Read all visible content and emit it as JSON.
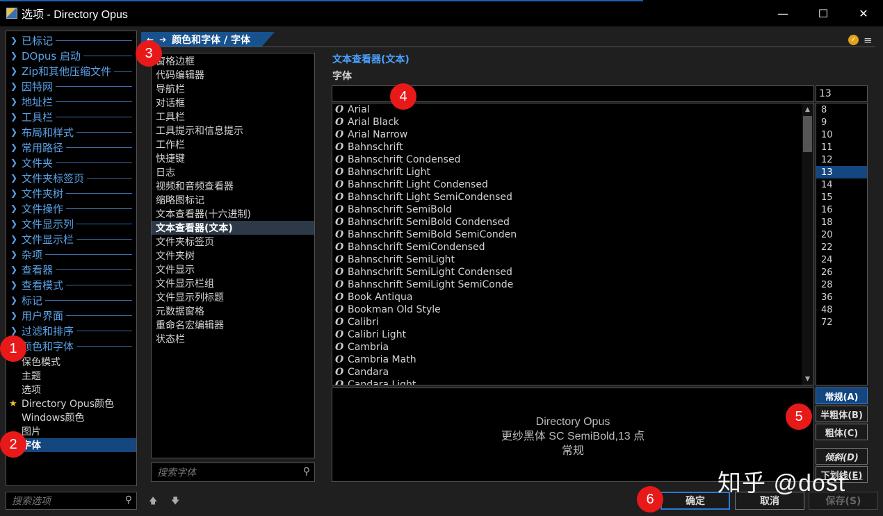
{
  "window": {
    "title": "选项 - Directory Opus",
    "min": "—",
    "max": "☐",
    "close": "✕"
  },
  "left_tree": {
    "sections": [
      {
        "label": "已标记"
      },
      {
        "label": "DOpus 启动"
      },
      {
        "label": "Zip和其他压缩文件"
      },
      {
        "label": "因特网"
      },
      {
        "label": "地址栏"
      },
      {
        "label": "工具栏"
      },
      {
        "label": "布局和样式"
      },
      {
        "label": "常用路径"
      },
      {
        "label": "文件夹"
      },
      {
        "label": "文件夹标签页"
      },
      {
        "label": "文件夹树"
      },
      {
        "label": "文件操作"
      },
      {
        "label": "文件显示列"
      },
      {
        "label": "文件显示栏"
      },
      {
        "label": "杂项"
      },
      {
        "label": "查看器"
      },
      {
        "label": "查看模式"
      },
      {
        "label": "标记"
      },
      {
        "label": "用户界面"
      },
      {
        "label": "过滤和排序"
      },
      {
        "label": "颜色和字体"
      }
    ],
    "subitems": [
      {
        "label": "保色模式"
      },
      {
        "label": "主题"
      },
      {
        "label": "选项"
      },
      {
        "label": "Directory Opus颜色"
      },
      {
        "label": "Windows颜色"
      },
      {
        "label": "图片"
      },
      {
        "label": "字体"
      }
    ],
    "search_placeholder": "搜索选项"
  },
  "breadcrumb": {
    "back": "←",
    "forward": "➔",
    "path": "颜色和字体 / 字体"
  },
  "header_icons": {
    "check": "✓",
    "menu": "≡"
  },
  "categories": {
    "items": [
      "窗格边框",
      "代码编辑器",
      "导航栏",
      "对话框",
      "工具栏",
      "工具提示和信息提示",
      "工作栏",
      "快捷键",
      "日志",
      "视频和音频查看器",
      "缩略图标记",
      "文本查看器(十六进制)",
      "文本查看器(文本)",
      "文件夹标签页",
      "文件夹树",
      "文件显示",
      "文件显示栏组",
      "文件显示列标题",
      "元数据窗格",
      "重命名宏编辑器",
      "状态栏"
    ],
    "selected_index": 12,
    "search_placeholder": "搜索字体"
  },
  "font_panel": {
    "title": "文本查看器(文本)",
    "subtitle": "字体",
    "font_name_value": "",
    "size_value": "13",
    "fonts": [
      "Arial",
      "Arial Black",
      "Arial Narrow",
      "Bahnschrift",
      "Bahnschrift Condensed",
      "Bahnschrift Light",
      "Bahnschrift Light Condensed",
      "Bahnschrift Light SemiCondensed",
      "Bahnschrift SemiBold",
      "Bahnschrift SemiBold Condensed",
      "Bahnschrift SemiBold SemiConden",
      "Bahnschrift SemiCondensed",
      "Bahnschrift SemiLight",
      "Bahnschrift SemiLight Condensed",
      "Bahnschrift SemiLight SemiConde",
      "Book Antiqua",
      "Bookman Old Style",
      "Calibri",
      "Calibri Light",
      "Cambria",
      "Cambria Math",
      "Candara",
      "Candara Light"
    ],
    "font_type_icon": "O",
    "sizes": [
      "8",
      "9",
      "10",
      "11",
      "12",
      "13",
      "14",
      "15",
      "16",
      "18",
      "20",
      "22",
      "24",
      "26",
      "28",
      "36",
      "48",
      "72"
    ],
    "selected_size": "13",
    "preview": {
      "line1": "Directory Opus",
      "line2": "更纱黑体 SC SemiBold,13 点",
      "line3": "常规"
    },
    "style_buttons": {
      "regular": "常规(A)",
      "semibold": "半粗体(B)",
      "bold": "粗体(C)",
      "italic": "倾斜(D)",
      "underline": "下划线(E)"
    }
  },
  "footer": {
    "move_up": "🡅",
    "move_down": "🡇",
    "ok": "确定",
    "cancel": "取消",
    "save": "保存(S)"
  },
  "annotations": {
    "m1": "1",
    "m2": "2",
    "m3": "3",
    "m4": "4",
    "m5": "5",
    "m6": "6"
  },
  "watermark": "知乎 @dost",
  "colors": {
    "accent_blue": "#4aa0ff",
    "selection": "#14467f",
    "marker_red": "#e81919"
  }
}
